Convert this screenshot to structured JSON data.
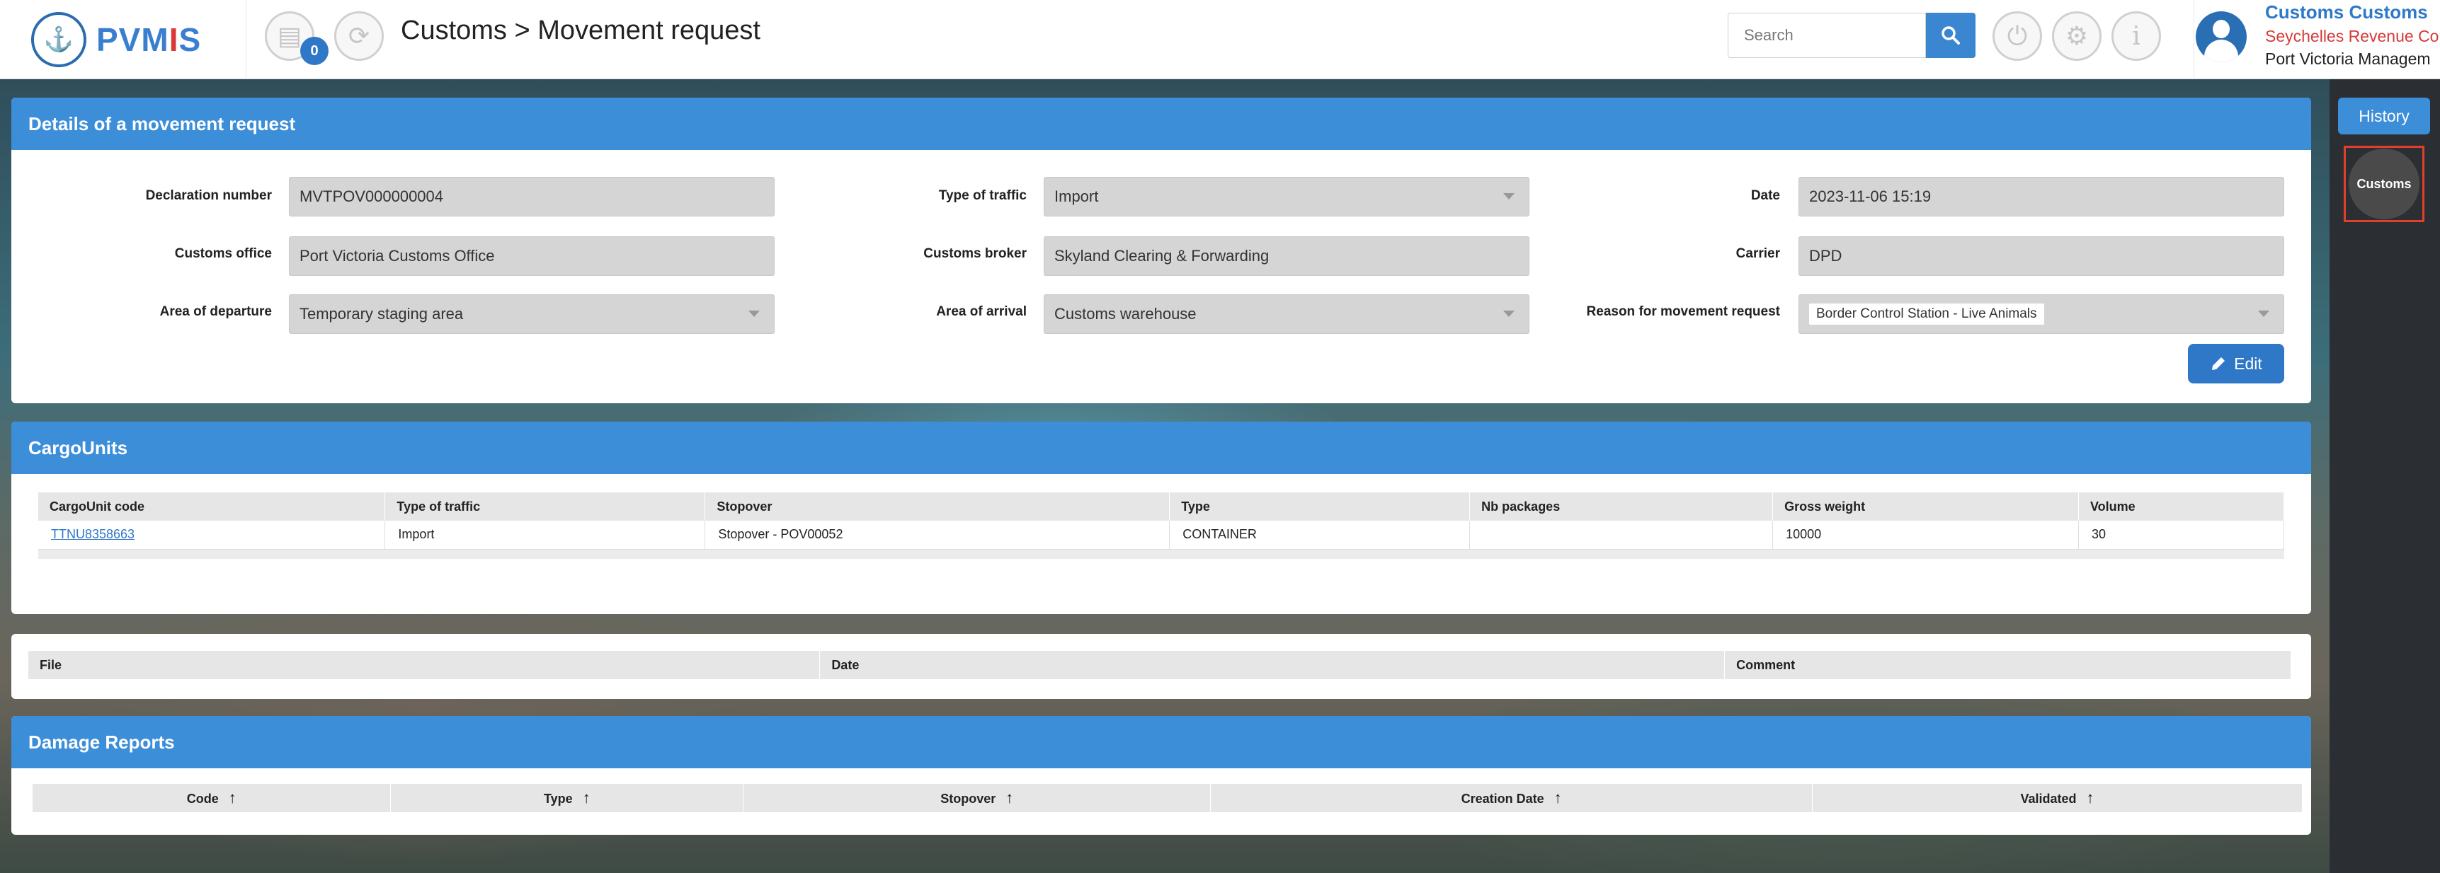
{
  "header": {
    "logo_text_1": "PVM",
    "logo_text_2": "I",
    "logo_text_3": "S",
    "badge_count": "0",
    "title": "Customs > Movement request",
    "search_placeholder": "Search",
    "user_name": "Customs Customs",
    "user_org": "Seychelles Revenue Co",
    "user_unit": "Port Victoria Managem"
  },
  "details": {
    "title": "Details of a movement request",
    "declaration_number_label": "Declaration number",
    "declaration_number": "MVTPOV000000004",
    "type_of_traffic_label": "Type of traffic",
    "type_of_traffic": "Import",
    "date_label": "Date",
    "date": "2023-11-06 15:19",
    "customs_office_label": "Customs office",
    "customs_office": "Port Victoria Customs Office",
    "customs_broker_label": "Customs broker",
    "customs_broker": "Skyland Clearing & Forwarding",
    "carrier_label": "Carrier",
    "carrier": "DPD",
    "area_departure_label": "Area of departure",
    "area_departure": "Temporary staging area",
    "area_arrival_label": "Area of arrival",
    "area_arrival": "Customs warehouse",
    "reason_label": "Reason for movement request",
    "reason": "Border Control Station - Live Animals",
    "edit_label": "Edit"
  },
  "cargo": {
    "title": "CargoUnits",
    "columns": [
      "CargoUnit code",
      "Type of traffic",
      "Stopover",
      "Type",
      "Nb packages",
      "Gross weight",
      "Volume"
    ],
    "rows": [
      [
        "TTNU8358663",
        "Import",
        "Stopover - POV00052",
        "CONTAINER",
        "",
        "10000",
        "30"
      ]
    ]
  },
  "files": {
    "columns": [
      "File",
      "Date",
      "Comment"
    ]
  },
  "damage": {
    "title": "Damage Reports",
    "columns": [
      "Code",
      "Type",
      "Stopover",
      "Creation Date",
      "Validated"
    ]
  },
  "sidebar": {
    "history_label": "History",
    "customs_label": "Customs"
  },
  "colors": {
    "accent": "#3d8ed9",
    "brand_red": "#d83a3a",
    "highlight_border": "#e0402a"
  }
}
